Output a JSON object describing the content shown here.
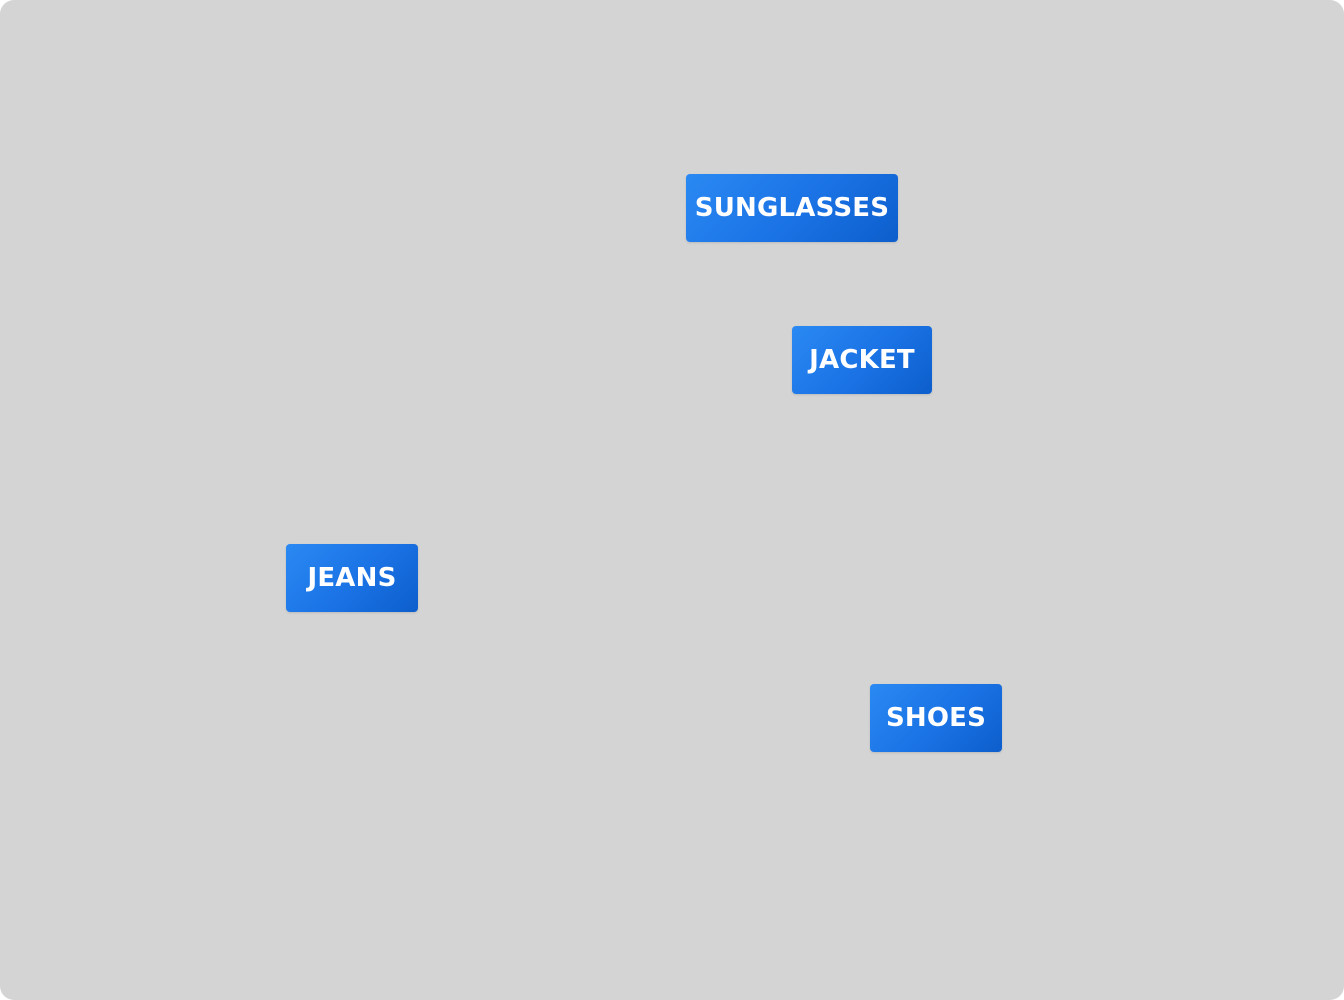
{
  "colors": {
    "canvas_background": "#d4d4d4",
    "tag_gradient_start": "#2a89f3",
    "tag_gradient_end": "#0d5ecc",
    "tag_text": "#ffffff"
  },
  "tags": [
    {
      "label": "SUNGLASSES"
    },
    {
      "label": "JACKET"
    },
    {
      "label": "JEANS"
    },
    {
      "label": "SHOES"
    }
  ]
}
